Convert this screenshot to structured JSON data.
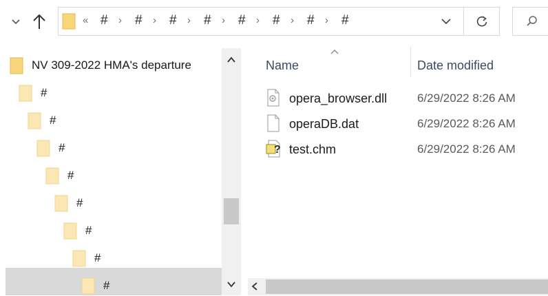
{
  "address_bar": {
    "overflow_glyph": "«",
    "crumbs": [
      "#",
      "#",
      "#",
      "#",
      "#",
      "#",
      "#",
      "#"
    ],
    "separator": "›"
  },
  "nav_pane": {
    "items": [
      {
        "label": "NV 309-2022 HMA's departure",
        "level": 0
      },
      {
        "label": "#",
        "level": 1
      },
      {
        "label": "#",
        "level": 2
      },
      {
        "label": "#",
        "level": 3
      },
      {
        "label": "#",
        "level": 4
      },
      {
        "label": "#",
        "level": 5
      },
      {
        "label": "#",
        "level": 6
      },
      {
        "label": "#",
        "level": 7
      },
      {
        "label": "#",
        "level": 8
      }
    ],
    "selected_index": 8
  },
  "content_pane": {
    "columns": {
      "name": "Name",
      "date_modified": "Date modified"
    },
    "files": [
      {
        "name": "opera_browser.dll",
        "date_modified": "6/29/2022 8:26 AM",
        "icon": "dll-file-icon"
      },
      {
        "name": "operaDB.dat",
        "date_modified": "6/29/2022 8:26 AM",
        "icon": "blank-file-icon"
      },
      {
        "name": "test.chm",
        "date_modified": "6/29/2022 8:26 AM",
        "icon": "chm-help-file-icon"
      }
    ]
  },
  "colors": {
    "folder": "#f7d77a",
    "folder_dark": "#e6b94a",
    "selection": "#d9d9d9",
    "scrollbar_thumb": "#c8c8c8",
    "header_text": "#3a4a66"
  }
}
